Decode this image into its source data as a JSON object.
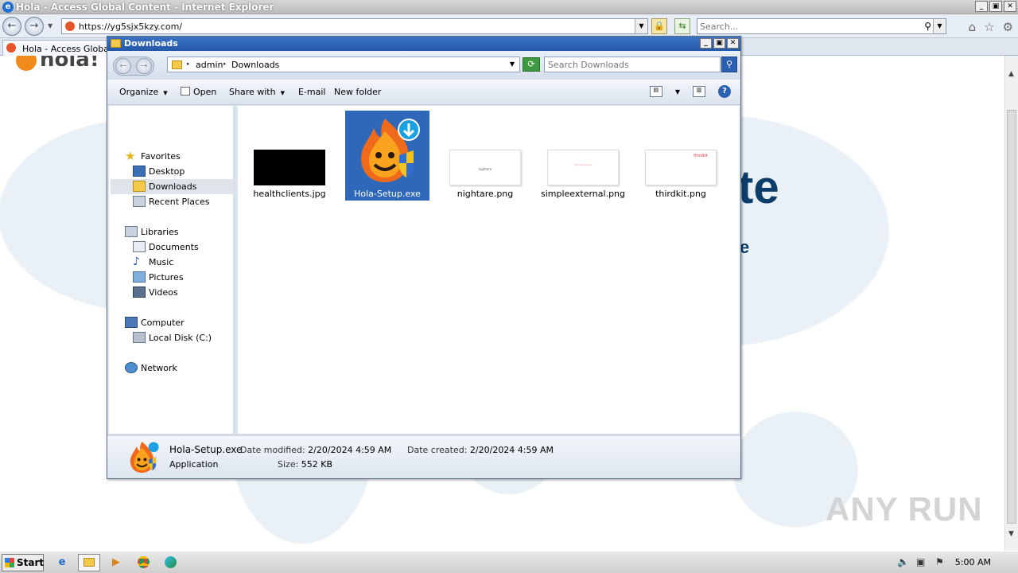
{
  "browser": {
    "title": "Hola - Access Global Content - Internet Explorer",
    "url": "https://yg5sjx5kzy.com/",
    "search_placeholder": "Search...",
    "tab_label": "Hola - Access Global C",
    "window_buttons": [
      "_",
      "▣",
      "✕"
    ]
  },
  "page": {
    "logo_text": "hola!",
    "hero_big": "te",
    "hero_small": "e",
    "watermark": "ANY RUN"
  },
  "explorer": {
    "title": "Downloads",
    "breadcrumb": [
      "admin",
      "Downloads"
    ],
    "search_placeholder": "Search Downloads",
    "commands": {
      "organize": "Organize",
      "open": "Open",
      "share_with": "Share with",
      "email": "E-mail",
      "new_folder": "New folder"
    },
    "nav": {
      "favorites": "Favorites",
      "desktop": "Desktop",
      "downloads": "Downloads",
      "recent_places": "Recent Places",
      "libraries": "Libraries",
      "documents": "Documents",
      "music": "Music",
      "pictures": "Pictures",
      "videos": "Videos",
      "computer": "Computer",
      "local_disk": "Local Disk (C:)",
      "network": "Network"
    },
    "files": [
      {
        "name": "healthclients.jpg",
        "preview_text": ""
      },
      {
        "name": "Hola-Setup.exe",
        "preview_text": ""
      },
      {
        "name": "nightare.png",
        "preview_text": "nightare"
      },
      {
        "name": "simpleexternal.png",
        "preview_text": "simpleexternal"
      },
      {
        "name": "thirdkit.png",
        "preview_text": "thirdkit"
      }
    ],
    "details": {
      "file_name": "Hola-Setup.exe",
      "file_type": "Application",
      "date_modified_label": "Date modified:",
      "date_modified": "2/20/2024 4:59 AM",
      "date_created_label": "Date created:",
      "date_created": "2/20/2024 4:59 AM",
      "size_label": "Size:",
      "size": "552 KB"
    }
  },
  "taskbar": {
    "start_label": "Start",
    "clock": "5:00 AM"
  },
  "colors": {
    "explorer_title": "#2358a7",
    "selection": "#2f68b8",
    "hero_text": "#0c3d6b"
  }
}
